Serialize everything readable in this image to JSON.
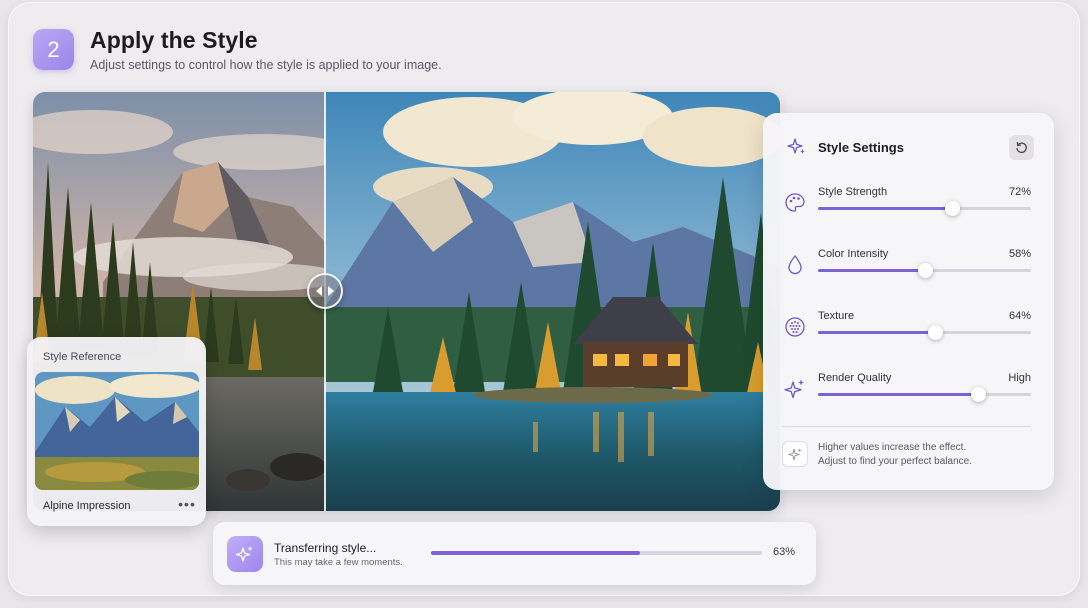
{
  "step": {
    "number": "2"
  },
  "header": {
    "title": "Apply the Style",
    "subtitle": "Adjust settings to control how the style is applied to your image."
  },
  "comparison": {
    "split_position": 0.39
  },
  "style_reference": {
    "label": "Style Reference",
    "name": "Alpine Impression",
    "more_icon": "more-horizontal-icon"
  },
  "settings": {
    "title": "Style Settings",
    "title_icon": "sparkles-icon",
    "reset_icon": "reset-icon",
    "items": [
      {
        "label": "Style Strength",
        "value": "72%",
        "level": 0.63,
        "icon": "palette-icon"
      },
      {
        "label": "Color Intensity",
        "value": "58%",
        "level": 0.5,
        "icon": "droplet-icon"
      },
      {
        "label": "Texture",
        "value": "64%",
        "level": 0.55,
        "icon": "texture-icon"
      },
      {
        "label": "Render Quality",
        "value": "High",
        "level": 0.75,
        "icon": "sparkles-icon"
      }
    ],
    "hint_line1": "Higher values increase the effect.",
    "hint_line2": "Adjust to find your perfect balance."
  },
  "progress": {
    "title": "Transferring style...",
    "subtitle": "This may take a few moments.",
    "percent_label": "63%",
    "fraction": 0.63
  },
  "colors": {
    "accent": "#7b63d4",
    "badge": "#a48ff0",
    "background": "#eeecef"
  }
}
